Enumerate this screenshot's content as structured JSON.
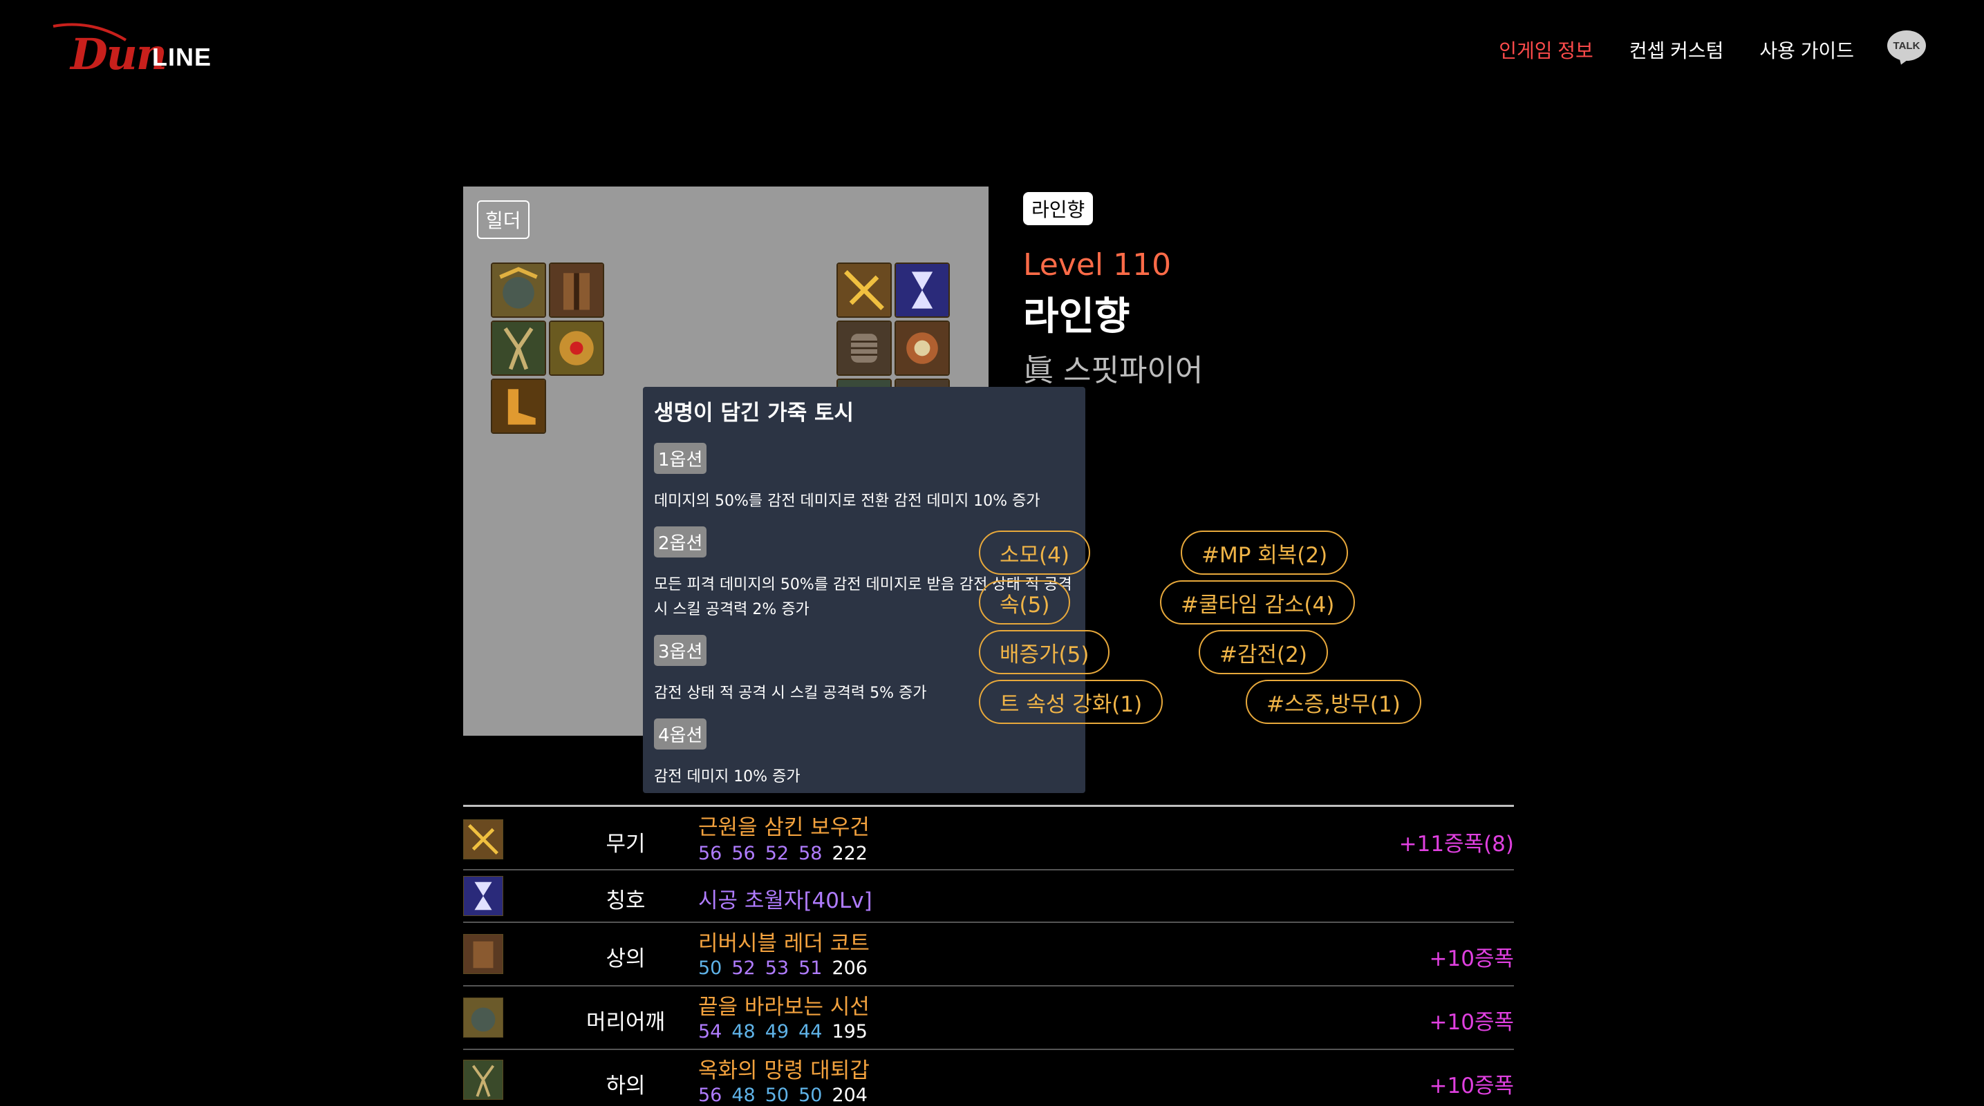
{
  "header": {
    "logo_dun": "Dun",
    "logo_line": "LINE",
    "nav": [
      {
        "label": "인게임 정보",
        "active": true
      },
      {
        "label": "컨셉 커스텀",
        "active": false
      },
      {
        "label": "사용 가이드",
        "active": false
      }
    ],
    "talk_label": "TALK"
  },
  "equip_panel": {
    "class_tag": "힐더"
  },
  "tooltip": {
    "title": "생명이 담긴 가죽 토시",
    "options": [
      {
        "label": "1옵션",
        "desc": "데미지의 50%를 감전 데미지로 전환 감전 데미지 10% 증가"
      },
      {
        "label": "2옵션",
        "desc": "모든 피격 데미지의 50%를 감전 데미지로 받음 감전 상태 적 공격 시 스킬 공격력 2% 증가"
      },
      {
        "label": "3옵션",
        "desc": "감전 상태 적 공격 시 스킬 공격력 5% 증가"
      },
      {
        "label": "4옵션",
        "desc": "감전 데미지 10% 증가"
      }
    ]
  },
  "profile": {
    "server_tag": "라인향",
    "level": "Level 110",
    "name": "라인향",
    "class_name": "眞 스핏파이어"
  },
  "tags": [
    "소모(4)",
    "#MP 회복(2)",
    "속(5)",
    "#쿨타임 감소(4)",
    "배증가(5)",
    "#감전(2)",
    "트 속성 강화(1)",
    "#스증,방무(1)"
  ],
  "colors": {
    "accent_red": "#ff4b4b",
    "level_orange": "#ff6b48",
    "tag_gold": "#e7a83b",
    "reinforce_pink": "#e040e0",
    "tooltip_bg": "#2c3444",
    "panel_gray": "#9a9a9a"
  },
  "equipment": [
    {
      "type": "무기",
      "name": "근원을 삼킨 보우건",
      "name_color": "orange",
      "stats": [
        {
          "v": "56",
          "c": "purple"
        },
        {
          "v": "56",
          "c": "purple"
        },
        {
          "v": "52",
          "c": "purple"
        },
        {
          "v": "58",
          "c": "purple"
        },
        {
          "v": "222",
          "c": "white"
        }
      ],
      "reinforce": "+11증폭(8)",
      "icon": "bow-icon"
    },
    {
      "type": "칭호",
      "name": "시공 초월자[40Lv]",
      "name_color": "purple",
      "stats": [],
      "reinforce": "",
      "icon": "hourglass-icon"
    },
    {
      "type": "상의",
      "name": "리버시블 레더 코트",
      "name_color": "orange",
      "stats": [
        {
          "v": "50",
          "c": "blue"
        },
        {
          "v": "52",
          "c": "purple"
        },
        {
          "v": "53",
          "c": "purple"
        },
        {
          "v": "51",
          "c": "purple"
        },
        {
          "v": "206",
          "c": "white"
        }
      ],
      "reinforce": "+10증폭",
      "icon": "coat-icon"
    },
    {
      "type": "머리어깨",
      "name": "끝을 바라보는 시선",
      "name_color": "orange",
      "stats": [
        {
          "v": "54",
          "c": "purple"
        },
        {
          "v": "48",
          "c": "blue"
        },
        {
          "v": "49",
          "c": "blue"
        },
        {
          "v": "44",
          "c": "blue"
        },
        {
          "v": "195",
          "c": "white"
        }
      ],
      "reinforce": "+10증폭",
      "icon": "shoulder-icon"
    },
    {
      "type": "하의",
      "name": "옥화의 망령 대퇴갑",
      "name_color": "orange",
      "stats": [
        {
          "v": "56",
          "c": "purple"
        },
        {
          "v": "48",
          "c": "blue"
        },
        {
          "v": "50",
          "c": "blue"
        },
        {
          "v": "50",
          "c": "blue"
        },
        {
          "v": "204",
          "c": "white"
        }
      ],
      "reinforce": "+10증폭",
      "icon": "pants-icon"
    }
  ]
}
